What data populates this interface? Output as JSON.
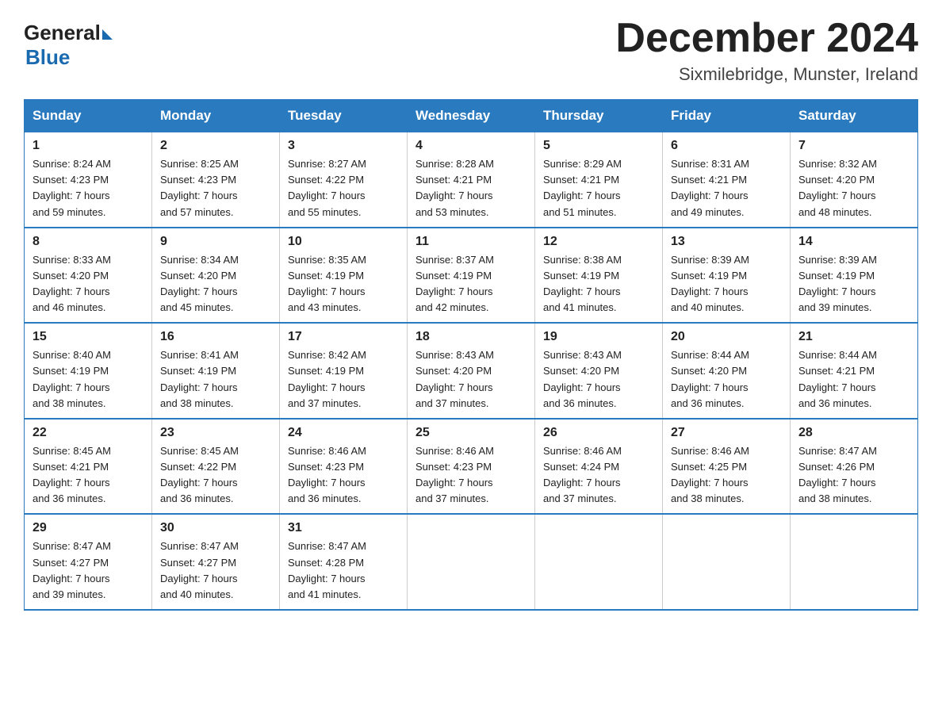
{
  "header": {
    "logo_general": "General",
    "logo_blue": "Blue",
    "month_year": "December 2024",
    "location": "Sixmilebridge, Munster, Ireland"
  },
  "weekdays": [
    "Sunday",
    "Monday",
    "Tuesday",
    "Wednesday",
    "Thursday",
    "Friday",
    "Saturday"
  ],
  "weeks": [
    [
      {
        "day": "1",
        "sunrise": "8:24 AM",
        "sunset": "4:23 PM",
        "daylight": "7 hours and 59 minutes."
      },
      {
        "day": "2",
        "sunrise": "8:25 AM",
        "sunset": "4:23 PM",
        "daylight": "7 hours and 57 minutes."
      },
      {
        "day": "3",
        "sunrise": "8:27 AM",
        "sunset": "4:22 PM",
        "daylight": "7 hours and 55 minutes."
      },
      {
        "day": "4",
        "sunrise": "8:28 AM",
        "sunset": "4:21 PM",
        "daylight": "7 hours and 53 minutes."
      },
      {
        "day": "5",
        "sunrise": "8:29 AM",
        "sunset": "4:21 PM",
        "daylight": "7 hours and 51 minutes."
      },
      {
        "day": "6",
        "sunrise": "8:31 AM",
        "sunset": "4:21 PM",
        "daylight": "7 hours and 49 minutes."
      },
      {
        "day": "7",
        "sunrise": "8:32 AM",
        "sunset": "4:20 PM",
        "daylight": "7 hours and 48 minutes."
      }
    ],
    [
      {
        "day": "8",
        "sunrise": "8:33 AM",
        "sunset": "4:20 PM",
        "daylight": "7 hours and 46 minutes."
      },
      {
        "day": "9",
        "sunrise": "8:34 AM",
        "sunset": "4:20 PM",
        "daylight": "7 hours and 45 minutes."
      },
      {
        "day": "10",
        "sunrise": "8:35 AM",
        "sunset": "4:19 PM",
        "daylight": "7 hours and 43 minutes."
      },
      {
        "day": "11",
        "sunrise": "8:37 AM",
        "sunset": "4:19 PM",
        "daylight": "7 hours and 42 minutes."
      },
      {
        "day": "12",
        "sunrise": "8:38 AM",
        "sunset": "4:19 PM",
        "daylight": "7 hours and 41 minutes."
      },
      {
        "day": "13",
        "sunrise": "8:39 AM",
        "sunset": "4:19 PM",
        "daylight": "7 hours and 40 minutes."
      },
      {
        "day": "14",
        "sunrise": "8:39 AM",
        "sunset": "4:19 PM",
        "daylight": "7 hours and 39 minutes."
      }
    ],
    [
      {
        "day": "15",
        "sunrise": "8:40 AM",
        "sunset": "4:19 PM",
        "daylight": "7 hours and 38 minutes."
      },
      {
        "day": "16",
        "sunrise": "8:41 AM",
        "sunset": "4:19 PM",
        "daylight": "7 hours and 38 minutes."
      },
      {
        "day": "17",
        "sunrise": "8:42 AM",
        "sunset": "4:19 PM",
        "daylight": "7 hours and 37 minutes."
      },
      {
        "day": "18",
        "sunrise": "8:43 AM",
        "sunset": "4:20 PM",
        "daylight": "7 hours and 37 minutes."
      },
      {
        "day": "19",
        "sunrise": "8:43 AM",
        "sunset": "4:20 PM",
        "daylight": "7 hours and 36 minutes."
      },
      {
        "day": "20",
        "sunrise": "8:44 AM",
        "sunset": "4:20 PM",
        "daylight": "7 hours and 36 minutes."
      },
      {
        "day": "21",
        "sunrise": "8:44 AM",
        "sunset": "4:21 PM",
        "daylight": "7 hours and 36 minutes."
      }
    ],
    [
      {
        "day": "22",
        "sunrise": "8:45 AM",
        "sunset": "4:21 PM",
        "daylight": "7 hours and 36 minutes."
      },
      {
        "day": "23",
        "sunrise": "8:45 AM",
        "sunset": "4:22 PM",
        "daylight": "7 hours and 36 minutes."
      },
      {
        "day": "24",
        "sunrise": "8:46 AM",
        "sunset": "4:23 PM",
        "daylight": "7 hours and 36 minutes."
      },
      {
        "day": "25",
        "sunrise": "8:46 AM",
        "sunset": "4:23 PM",
        "daylight": "7 hours and 37 minutes."
      },
      {
        "day": "26",
        "sunrise": "8:46 AM",
        "sunset": "4:24 PM",
        "daylight": "7 hours and 37 minutes."
      },
      {
        "day": "27",
        "sunrise": "8:46 AM",
        "sunset": "4:25 PM",
        "daylight": "7 hours and 38 minutes."
      },
      {
        "day": "28",
        "sunrise": "8:47 AM",
        "sunset": "4:26 PM",
        "daylight": "7 hours and 38 minutes."
      }
    ],
    [
      {
        "day": "29",
        "sunrise": "8:47 AM",
        "sunset": "4:27 PM",
        "daylight": "7 hours and 39 minutes."
      },
      {
        "day": "30",
        "sunrise": "8:47 AM",
        "sunset": "4:27 PM",
        "daylight": "7 hours and 40 minutes."
      },
      {
        "day": "31",
        "sunrise": "8:47 AM",
        "sunset": "4:28 PM",
        "daylight": "7 hours and 41 minutes."
      },
      null,
      null,
      null,
      null
    ]
  ],
  "labels": {
    "sunrise": "Sunrise:",
    "sunset": "Sunset:",
    "daylight": "Daylight:"
  }
}
